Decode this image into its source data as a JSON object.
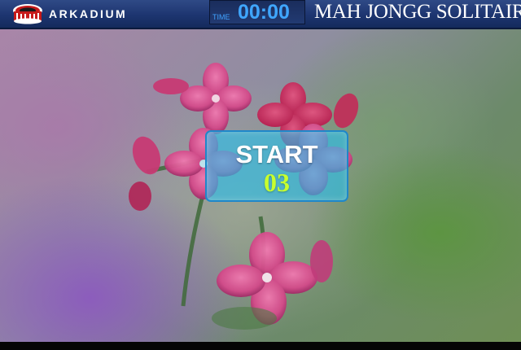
{
  "header": {
    "logo_icon": "arkadium-logo-icon",
    "brand": "ARKADIUM",
    "timer_label": "TIME",
    "timer_value": "00:00",
    "game_title": "MAH JONGG SOLITAIRE"
  },
  "start_panel": {
    "label": "START",
    "countdown": "03"
  },
  "colors": {
    "header_bg": "#1d3570",
    "timer_text": "#3fa6ff",
    "panel_bg": "#28beeb",
    "countdown_text": "#c8ff2e"
  },
  "background": "pink-flowers-photo"
}
